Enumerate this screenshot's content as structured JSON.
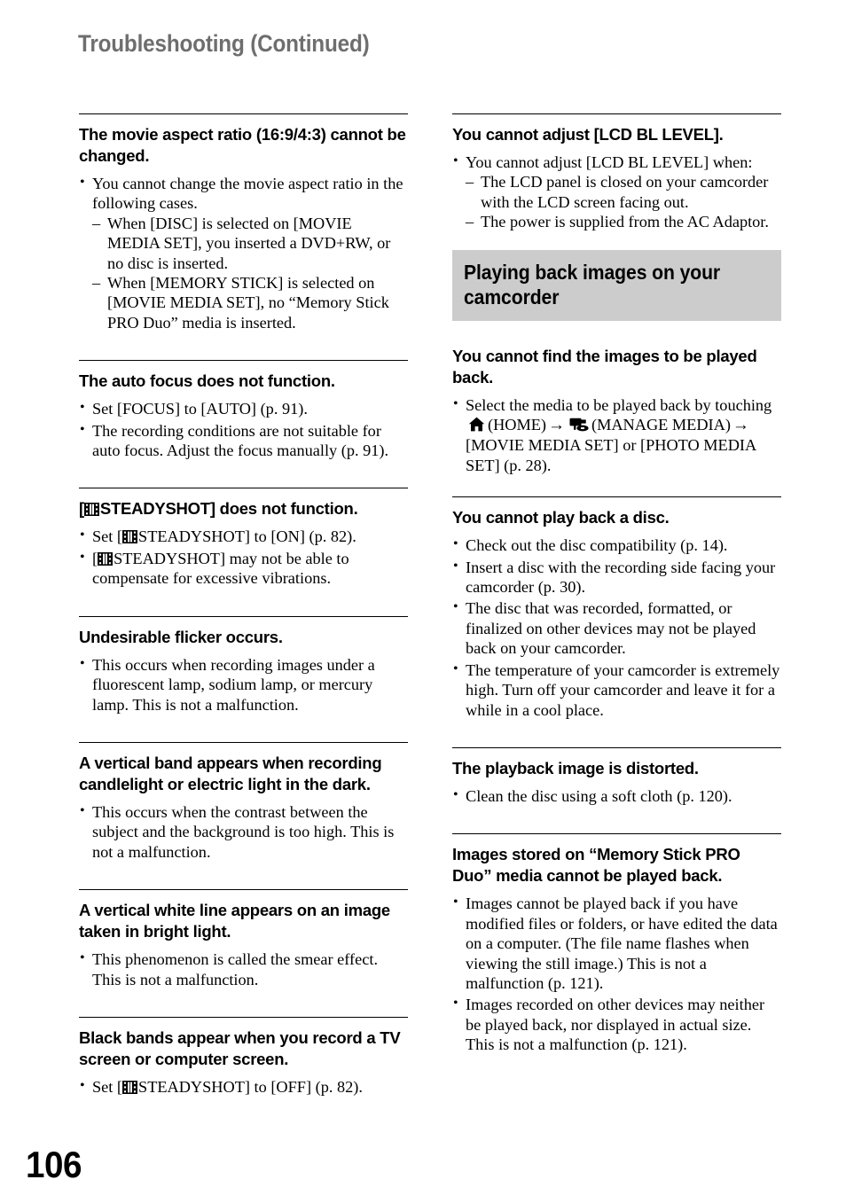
{
  "page": {
    "running_head": "Troubleshooting (Continued)",
    "folio": "106"
  },
  "icons": {
    "film": "film-strip-icon",
    "home": "home-icon",
    "manage_media": "manage-media-icon",
    "arrow": "→"
  },
  "left_column": [
    {
      "id": "movie-aspect-ratio",
      "heading": "The movie aspect ratio (16:9/4:3) cannot be changed.",
      "bullets": [
        {
          "text": "You cannot change the movie aspect ratio in the following cases.",
          "sub": [
            "When [DISC] is selected on [MOVIE MEDIA SET], you inserted a DVD+RW, or no disc is inserted.",
            "When [MEMORY STICK] is selected on [MOVIE MEDIA SET], no “Memory Stick PRO Duo” media is inserted."
          ]
        }
      ]
    },
    {
      "id": "auto-focus",
      "heading": "The auto focus does not function.",
      "bullets": [
        {
          "text": "Set [FOCUS] to [AUTO] (p. 91)."
        },
        {
          "text": "The recording conditions are not suitable for auto focus. Adjust the focus manually (p. 91)."
        }
      ]
    },
    {
      "id": "steadyshot",
      "heading_pre": "[",
      "heading_icon": "film",
      "heading_post": "STEADYSHOT] does not function.",
      "bullets": [
        {
          "pre": "Set [",
          "icon": "film",
          "post": "STEADYSHOT] to [ON] (p. 82)."
        },
        {
          "pre": "[",
          "icon": "film",
          "post": "STEADYSHOT] may not be able to compensate for excessive vibrations."
        }
      ]
    },
    {
      "id": "flicker",
      "heading": "Undesirable flicker occurs.",
      "bullets": [
        {
          "text": "This occurs when recording images under a fluorescent lamp, sodium lamp, or mercury lamp. This is not a malfunction."
        }
      ]
    },
    {
      "id": "vertical-band",
      "heading": "A vertical band appears when recording candlelight or electric light in the dark.",
      "bullets": [
        {
          "text": "This occurs when the contrast between the subject and the background is too high. This is not a malfunction."
        }
      ]
    },
    {
      "id": "vertical-white-line",
      "heading": "A vertical white line appears on an image taken in bright light.",
      "bullets": [
        {
          "text": "This phenomenon is called the smear effect. This is not a malfunction."
        }
      ]
    },
    {
      "id": "black-bands",
      "heading": "Black bands appear when you record a TV screen or computer screen.",
      "bullets": [
        {
          "pre": "Set [",
          "icon": "film",
          "post": "STEADYSHOT] to [OFF] (p. 82)."
        }
      ]
    }
  ],
  "right_column": [
    {
      "id": "lcd-bl-level",
      "heading": "You cannot adjust [LCD BL LEVEL].",
      "bullets": [
        {
          "text": "You cannot adjust [LCD BL LEVEL] when:",
          "sub": [
            "The LCD panel is closed on your camcorder with the LCD screen facing out.",
            "The power is supplied from the AC Adaptor."
          ]
        }
      ]
    },
    {
      "id": "section-playing-back",
      "section_title": "Playing back images on your camcorder"
    },
    {
      "id": "cannot-find-images",
      "heading": "You cannot find the images to be played back.",
      "bullets": [
        {
          "seg_a": "Select the media to be played back by touching",
          "icon_a": "home",
          "seg_b": "(HOME)",
          "arrow_1": "→",
          "icon_b": "media",
          "seg_c": "(MANAGE MEDIA)",
          "arrow_2": "→",
          "seg_d": "[MOVIE MEDIA SET] or [PHOTO MEDIA SET] (p. 28)."
        }
      ]
    },
    {
      "id": "cannot-play-disc",
      "heading": "You cannot play back a disc.",
      "bullets": [
        {
          "text": "Check out the disc compatibility (p. 14)."
        },
        {
          "text": "Insert a disc with the recording side facing your camcorder (p. 30)."
        },
        {
          "text": "The disc that was recorded, formatted, or finalized on other devices may not be played back on your camcorder."
        },
        {
          "text": "The temperature of your camcorder is extremely high. Turn off your camcorder and leave it for a while in a cool place."
        }
      ]
    },
    {
      "id": "playback-distorted",
      "heading": "The playback image is distorted.",
      "bullets": [
        {
          "text": "Clean the disc using a soft cloth (p. 120)."
        }
      ]
    },
    {
      "id": "memory-stick-images",
      "heading": "Images stored on “Memory Stick PRO Duo” media cannot be played back.",
      "bullets": [
        {
          "text": "Images cannot be played back if you have modified files or folders, or have edited the data on a computer. (The file name flashes when viewing the still image.) This is not a malfunction (p. 121)."
        },
        {
          "text": "Images recorded on other devices may neither be played back, nor displayed in actual size. This is not a malfunction (p. 121)."
        }
      ]
    }
  ]
}
